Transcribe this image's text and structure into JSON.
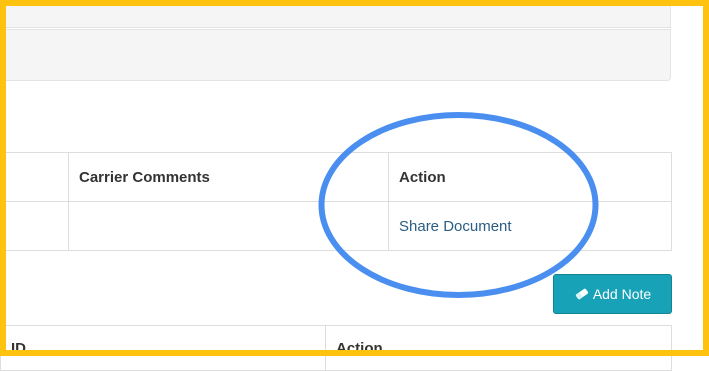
{
  "documents_table": {
    "headers": [
      "",
      "Carrier Comments",
      "Action"
    ],
    "rows": [
      {
        "col1": "",
        "carrier_comments": "",
        "action_link": "Share Document"
      }
    ]
  },
  "notes": {
    "add_note_label": "Add Note",
    "add_note_icon": "eraser-icon",
    "table_headers": [
      "ID",
      "Action"
    ]
  },
  "annotations": {
    "highlight_color": "#4a8ff0",
    "frame_color": "#ffc20e"
  },
  "colors": {
    "button_bg": "#17a2b8",
    "link": "#2a5d84"
  }
}
